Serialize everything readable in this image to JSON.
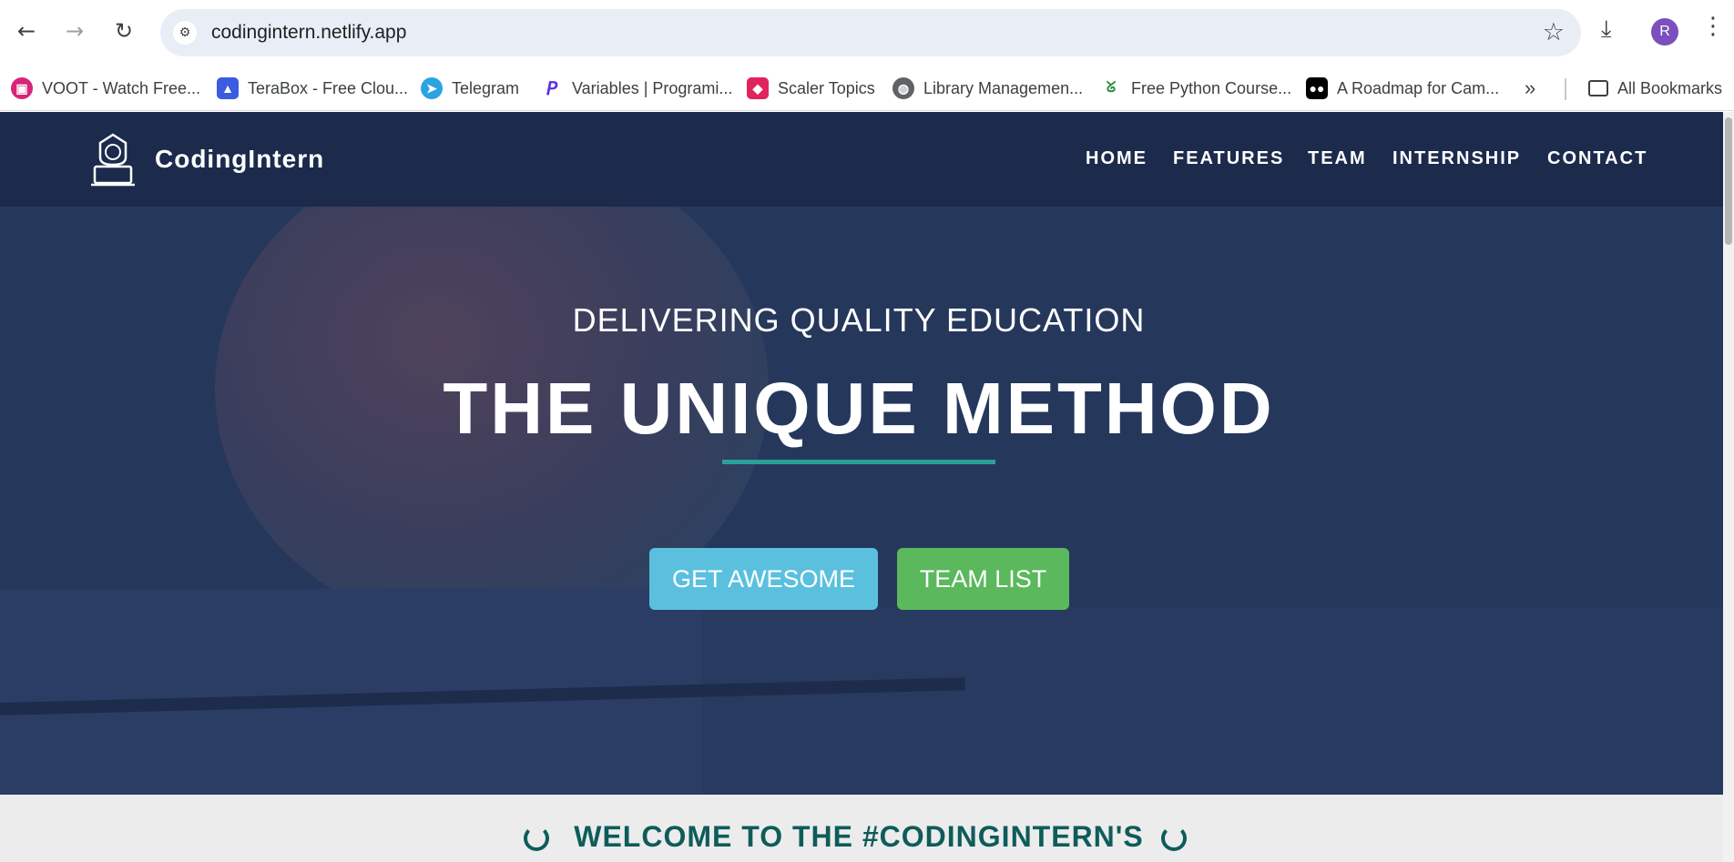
{
  "browser": {
    "url": "codingintern.netlify.app",
    "profile_initial": "R",
    "bookmarks": [
      {
        "label": "VOOT - Watch Free...",
        "icon": "voot-icon"
      },
      {
        "label": "TeraBox - Free Clou...",
        "icon": "terabox-icon"
      },
      {
        "label": "Telegram",
        "icon": "telegram-icon"
      },
      {
        "label": "Variables | Programi...",
        "icon": "variables-icon"
      },
      {
        "label": "Scaler Topics",
        "icon": "scaler-icon"
      },
      {
        "label": "Library Managemen...",
        "icon": "globe-icon"
      },
      {
        "label": "Free Python Course...",
        "icon": "gfg-icon"
      },
      {
        "label": "A Roadmap for Cam...",
        "icon": "medium-icon"
      }
    ],
    "all_bookmarks_label": "All Bookmarks",
    "icons": {
      "back": "←",
      "forward": "→",
      "reload": "↻",
      "star": "☆",
      "download": "⤓",
      "menu": "⋮",
      "more": "»",
      "site_info": "⚙"
    }
  },
  "site": {
    "brand": "CodingIntern",
    "nav": [
      "HOME",
      "FEATURES",
      "TEAM",
      "INTERNSHIP",
      "CONTACT"
    ],
    "hero": {
      "subtitle": "DELIVERING QUALITY EDUCATION",
      "title": "THE UNIQUE METHOD",
      "button_primary": "GET AWESOME",
      "button_secondary": "TEAM LIST"
    },
    "welcome": "WELCOME TO THE #CODINGINTERN'S"
  },
  "colors": {
    "nav_bg": "#1c2a4c",
    "accent": "#2aa198",
    "btn_info": "#5bc0de",
    "btn_success": "#5cb85c",
    "welcome_text": "#0e5c5a"
  }
}
